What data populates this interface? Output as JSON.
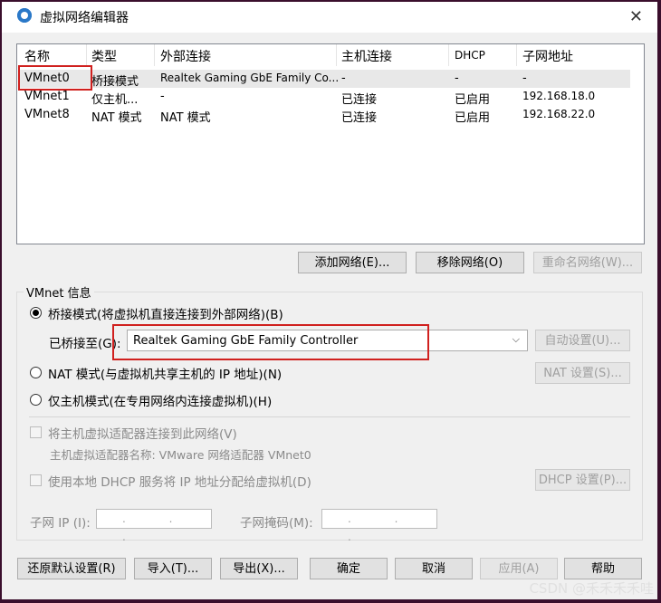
{
  "window": {
    "title": "虚拟网络编辑器",
    "close_glyph": "✕"
  },
  "table": {
    "headers": [
      "名称",
      "类型",
      "外部连接",
      "主机连接",
      "DHCP",
      "子网地址"
    ],
    "rows": [
      {
        "name": "VMnet0",
        "type": "桥接模式",
        "external": "Realtek Gaming GbE Family Co...",
        "host": "-",
        "dhcp": "-",
        "subnet": "-"
      },
      {
        "name": "VMnet1",
        "type": "仅主机...",
        "external": "-",
        "host": "已连接",
        "dhcp": "已启用",
        "subnet": "192.168.18.0"
      },
      {
        "name": "VMnet8",
        "type": "NAT 模式",
        "external": "NAT 模式",
        "host": "已连接",
        "dhcp": "已启用",
        "subnet": "192.168.22.0"
      }
    ]
  },
  "list_buttons": {
    "add": "添加网络(E)...",
    "remove": "移除网络(O)",
    "rename": "重命名网络(W)..."
  },
  "vmnet_info": {
    "label": "VMnet 信息",
    "bridge_radio": "桥接模式(将虚拟机直接连接到外部网络)(B)",
    "bridged_to_label": "已桥接至(G):",
    "bridged_to_value": "Realtek Gaming GbE Family Controller",
    "auto_settings": "自动设置(U)...",
    "nat_radio": "NAT 模式(与虚拟机共享主机的 IP 地址)(N)",
    "nat_settings": "NAT 设置(S)...",
    "host_only_radio": "仅主机模式(在专用网络内连接虚拟机)(H)",
    "connect_adapter": "将主机虚拟适配器连接到此网络(V)",
    "adapter_name": "主机虚拟适配器名称: VMware 网络适配器 VMnet0",
    "use_dhcp": "使用本地 DHCP 服务将 IP 地址分配给虚拟机(D)",
    "dhcp_settings": "DHCP 设置(P)...",
    "subnet_ip_label": "子网 IP (I):",
    "subnet_mask_label": "子网掩码(M):",
    "ip_placeholder": ". . .",
    "mask_placeholder": ". . ."
  },
  "bottom_buttons": {
    "restore": "还原默认设置(R)",
    "import": "导入(T)...",
    "export": "导出(X)...",
    "ok": "确定",
    "cancel": "取消",
    "apply": "应用(A)",
    "help": "帮助"
  },
  "watermark": "CSDN @禾禾禾禾哇"
}
